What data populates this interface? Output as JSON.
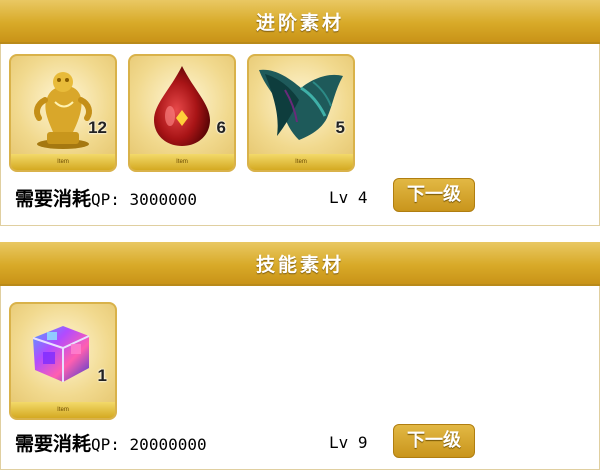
{
  "ascension": {
    "title": "进阶素材",
    "items": [
      {
        "icon": "golden-statue-icon",
        "count": "12",
        "tag": "Item"
      },
      {
        "icon": "red-drop-icon",
        "count": "6",
        "tag": "Item"
      },
      {
        "icon": "dark-wing-icon",
        "count": "5",
        "tag": "Item"
      }
    ],
    "cost_label": "需要消耗",
    "qp_text": "QP: 3000000",
    "level": "Lv 4",
    "next_button": "下一级"
  },
  "skill": {
    "title": "技能素材",
    "items": [
      {
        "icon": "crystal-cube-icon",
        "count": "1",
        "tag": "Item"
      }
    ],
    "cost_label": "需要消耗",
    "qp_text": "QP: 20000000",
    "level": "Lv 9",
    "next_button": "下一级"
  },
  "colors": {
    "header_gold": "#d8aa28",
    "button_gold": "#c9951c"
  }
}
